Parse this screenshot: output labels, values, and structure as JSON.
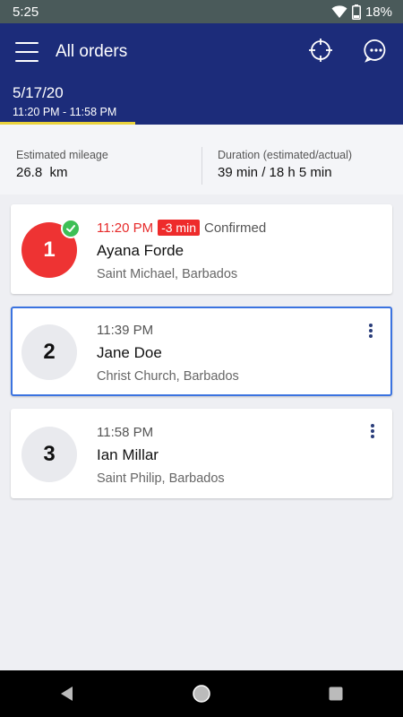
{
  "status_bar": {
    "time": "5:25",
    "battery": "18%"
  },
  "app_bar": {
    "title": "All orders",
    "date": "5/17/20",
    "time_range": "11:20 PM - 11:58 PM",
    "accent_color": "#e9d23c"
  },
  "stats": {
    "mileage_label": "Estimated mileage",
    "mileage_value": "26.8  km",
    "duration_label": "Duration (estimated/actual)",
    "duration_value": "39 min / 18 h 5 min"
  },
  "orders": [
    {
      "number": "1",
      "time": "11:20 PM",
      "delay": "-3 min",
      "status": "Confirmed",
      "customer": "Ayana Forde",
      "address": "Saint Michael, Barbados",
      "completed": true
    },
    {
      "number": "2",
      "time": "11:39 PM",
      "customer": "Jane Doe",
      "address": "Christ Church, Barbados",
      "selected": true
    },
    {
      "number": "3",
      "time": "11:58 PM",
      "customer": "Ian Millar",
      "address": "Saint Philip, Barbados"
    }
  ],
  "colors": {
    "primary": "#1c2c7a",
    "late": "#e62a2a",
    "success": "#3dbf55",
    "selected_border": "#3b73e0"
  }
}
